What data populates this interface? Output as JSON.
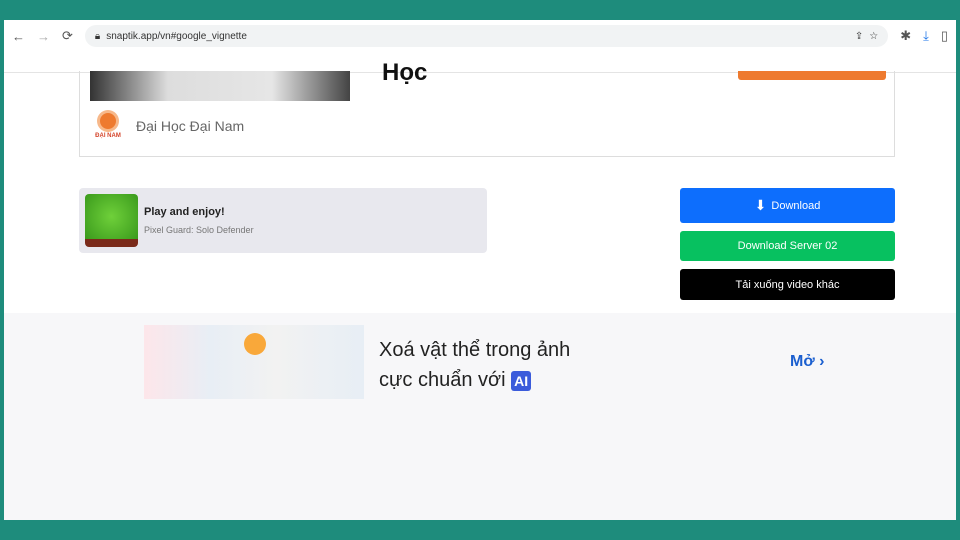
{
  "browser": {
    "url": "snaptik.app/vn#google_vignette"
  },
  "ad_card": {
    "title_fragment": "Học",
    "advertiser": "Đại Học Đại Nam",
    "logo_text": "ĐẠI NAM"
  },
  "game_ad": {
    "title": "Play and enjoy!",
    "subtitle": "Pixel Guard: Solo Defender"
  },
  "buttons": {
    "download": "Download",
    "server2": "Download Server 02",
    "other": "Tải xuống video khác"
  },
  "banner": {
    "line1": "Xoá vật thể trong ảnh",
    "line2": "cực chuẩn với",
    "ai_badge": "AI",
    "open": "Mở"
  },
  "colors": {
    "download": "#0d6efd",
    "server2": "#07c160",
    "other": "#000000",
    "accent_orange": "#ee7a2f"
  }
}
